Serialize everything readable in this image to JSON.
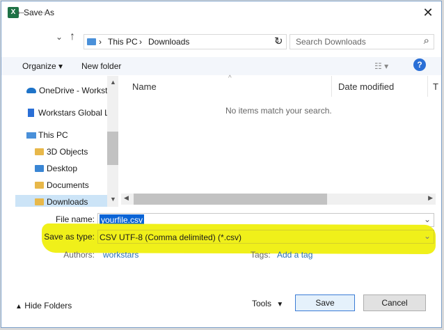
{
  "window": {
    "title": "Save As",
    "app_icon": "excel-icon",
    "close_label": "✕"
  },
  "nav": {
    "back": "←",
    "forward": "→",
    "dropdown": "⌄",
    "up": "↑"
  },
  "address": {
    "segments": [
      "This PC",
      "Downloads"
    ],
    "separator": "›",
    "dropdown": "⌄"
  },
  "refresh": "↻",
  "search": {
    "placeholder": "Search Downloads",
    "icon": "⌕"
  },
  "toolbar": {
    "organize": "Organize ▾",
    "new_folder": "New folder",
    "view": "☷ ▾",
    "help": "?"
  },
  "sidebar": {
    "items": [
      {
        "label": "OneDrive - Workst",
        "icon": "cloud-icon"
      },
      {
        "label": "Workstars Global L",
        "icon": "building-icon"
      },
      {
        "label": "This PC",
        "icon": "computer-icon"
      },
      {
        "label": "3D Objects",
        "icon": "folder-icon"
      },
      {
        "label": "Desktop",
        "icon": "folder-icon"
      },
      {
        "label": "Documents",
        "icon": "folder-icon"
      },
      {
        "label": "Downloads",
        "icon": "folder-icon",
        "selected": true
      }
    ]
  },
  "columns": {
    "name": "Name",
    "date_modified": "Date modified",
    "type": "T"
  },
  "empty_message": "No items match your search.",
  "form": {
    "file_name_label": "File name:",
    "file_name_value": "yourfile.csv",
    "save_as_type_label": "Save as type:",
    "save_as_type_value": "CSV UTF-8 (Comma delimited) (*.csv)",
    "authors_label": "Authors:",
    "authors_value": "workstars",
    "tags_label": "Tags:",
    "tags_value": "Add a tag"
  },
  "footer": {
    "hide_folders": "Hide Folders",
    "tools": "Tools",
    "tools_arrow": "▼",
    "save": "Save",
    "cancel": "Cancel"
  },
  "colors": {
    "highlight": "#f0f01a",
    "accent": "#2a6fd6",
    "link": "#2a6fb8"
  }
}
